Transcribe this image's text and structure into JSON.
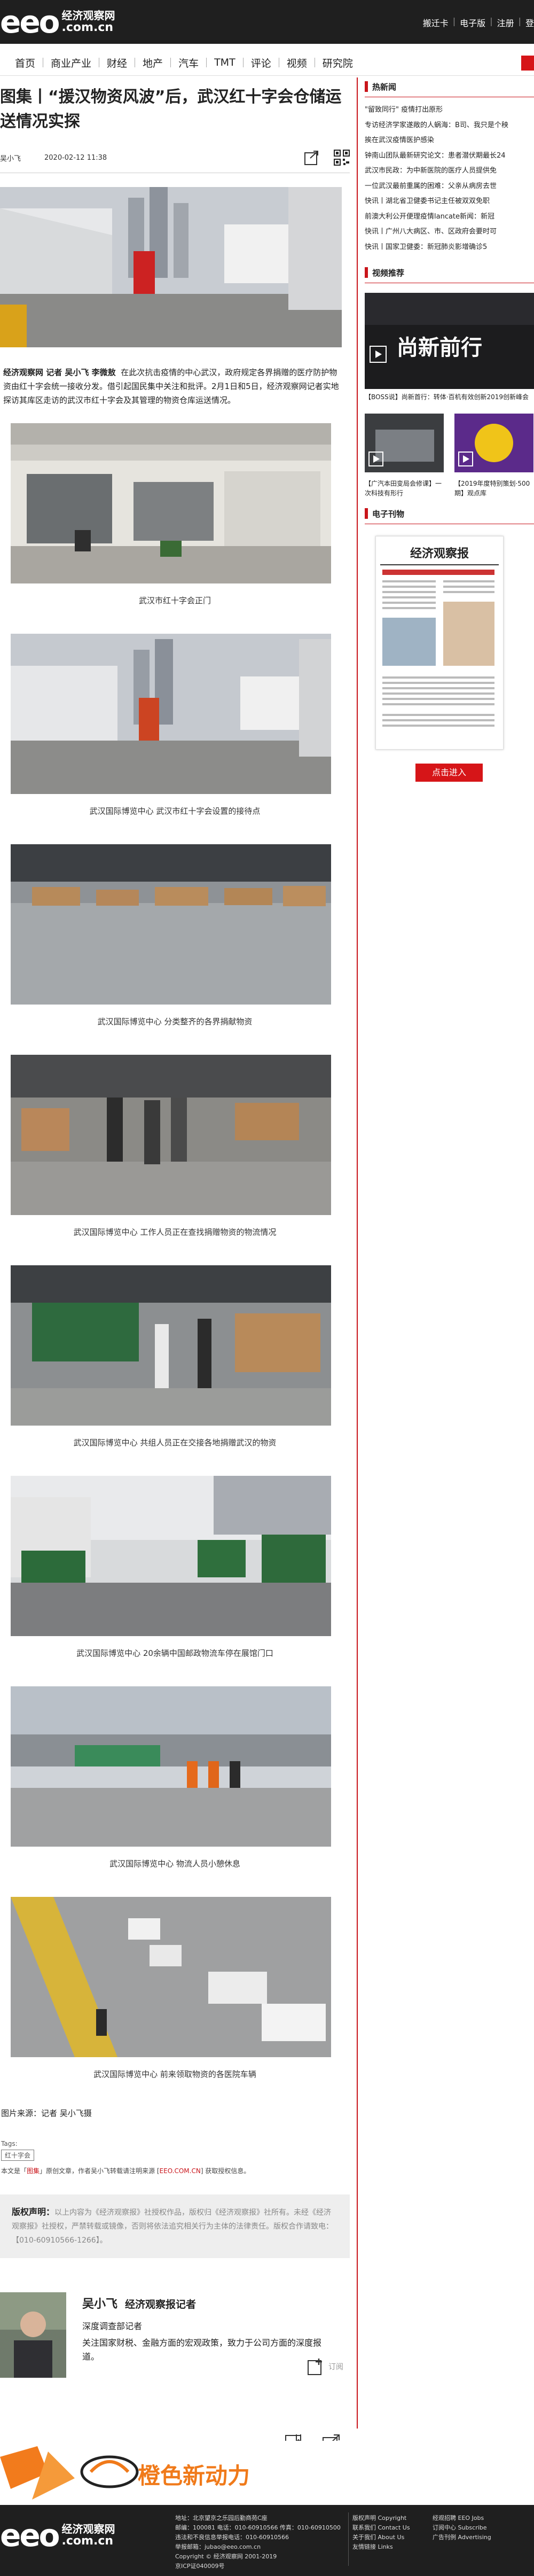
{
  "header": {
    "logo_mark": "eeo",
    "logo_cn": "经济观察网",
    "logo_domain": ".com.cn",
    "links": [
      "搬迁卡",
      "电子版",
      "注册",
      "登"
    ],
    "nav": [
      "首页",
      "商业产业",
      "财经",
      "地产",
      "汽车",
      "TMT",
      "评论",
      "视频",
      "研究院"
    ]
  },
  "article": {
    "title": "图集丨“援汉物资风波”后，武汉红十字会仓储运送情况实探",
    "author": "吴小飞",
    "date": "2020-02-12 11:38",
    "lead_reporters": "经济观察网  记者  吴小飞  李微敖",
    "lead_body": "在此次抗击疫情的中心武汉，政府规定各界捐赠的医疗防护物资由红十字会统一接收分发。借引起国民集中关注和批评。2月1日和5日，经济观察网记者实地探访其库区走访的武汉市红十字会及其管理的物资仓库运送情况。",
    "photos": [
      {
        "caption": "武汉市红十字会正门"
      },
      {
        "caption": "武汉国际博览中心 武汉市红十字会设置的接待点"
      },
      {
        "caption": "武汉国际博览中心 分类整齐的各界捐献物资"
      },
      {
        "caption": "武汉国际博览中心 工作人员正在查找捐赠物资的物流情况"
      },
      {
        "caption": "武汉国际博览中心 共组人员正在交接各地捐赠武汉的物资"
      },
      {
        "caption": "武汉国际博览中心 20余辆中国邮政物流车停在展馆门口"
      },
      {
        "caption": "武汉国际博览中心 物流人员小憩休息"
      },
      {
        "caption": "武汉国际博览中心 前来领取物资的各医院车辆"
      }
    ],
    "source": "图片来源：记者 吴小飞摄",
    "tags_label": "Tags:",
    "tag": "红十字会",
    "copyright_pre": "本文是「",
    "copyright_em": "图集",
    "copyright_mid": "」原创文章，作者吴小飞转载请注明来源",
    "copyright_link": "EEO.COM.CN",
    "copyright_post": "获取授权信息。",
    "statement_title": "版权声明：",
    "statement_body": "以上内容为《经济观察报》社授权作品，版权归《经济观察报》社所有。未经《经济观察报》社授权，严禁转载或镜像，否则将依法追究相关行为主体的法律责任。版权合作请致电：【010-60910566-1266】。"
  },
  "author_card": {
    "name": "吴小飞",
    "title": "经济观察报记者",
    "sub": "深度调查部记者",
    "desc": "关注国家财税、金融方面的宏观政策，致力于公司方面的深度报道。",
    "follow_label": "订阅"
  },
  "actions": [
    {
      "label": "收藏",
      "icon": "bookmark-icon"
    },
    {
      "label": "分享",
      "icon": "share-icon"
    }
  ],
  "banner": {
    "text": "橙色新动力"
  },
  "sidebar": {
    "hot_title": "热新闻",
    "hot_items": [
      "\"留致同行\" 疫情打出原形",
      "专访经济学家遂敞的人蜗海：B司、我只是个秧",
      "挨在武汉疫情医护感染",
      "钟南山团队最新研究论文：患者潜伏期最长24",
      "武汉市民政：为中新医院的医疗人员提供免",
      "一位武汉最前重属的困难：父亲从病房去世",
      "快讯丨湖北省卫健委书记主任被双双免职",
      "前澳大利公开便理疫情lancate新闻：新冠",
      "快讯丨广州八大病区、市、区政府会要时可",
      "快讯丨国家卫健委：新冠肺炎影增确诊5"
    ],
    "video_title": "视频推荐",
    "video_main_caption": "【BOSS说】尚新首行：转体·百机有效创新2019创新峰会",
    "video_main_overlay": "尚新前行",
    "video_small": [
      {
        "caption": "【广汽本田变局会修课】一次科技有形行"
      },
      {
        "caption": "【2019年度特别策划·500期】观点库"
      }
    ],
    "paper_title": "电子刊物",
    "paper_masthead": "经济观察报",
    "enter_label": "点击进入"
  },
  "footer": {
    "logo_mark": "eeo",
    "logo_cn": "经济观察网",
    "logo_domain": ".com.cn",
    "col1": [
      "地址：北京望京之乐园后勤商苑C座",
      "邮编：100081  电话：010-60910566  传真：010-60910500",
      "违法和不良信息举报电话：010-60910566",
      "举报邮箱：jubao@eeo.com.cn",
      "Copyright © 经济观察网 2001-2019",
      "京ICP证040009号"
    ],
    "col2": [
      "版权声明 Copyright",
      "联系我们 Contact Us",
      "关于我们 About Us",
      "友情链接 Links"
    ],
    "col3": [
      "经观招聘 EEO Jobs",
      "订阅中心 Subscribe",
      "广告刊例 Advertising"
    ]
  },
  "colors": {
    "accent": "#c9151b",
    "header_bg": "#1f1f1f",
    "banner_orange": "#f07a1a"
  }
}
